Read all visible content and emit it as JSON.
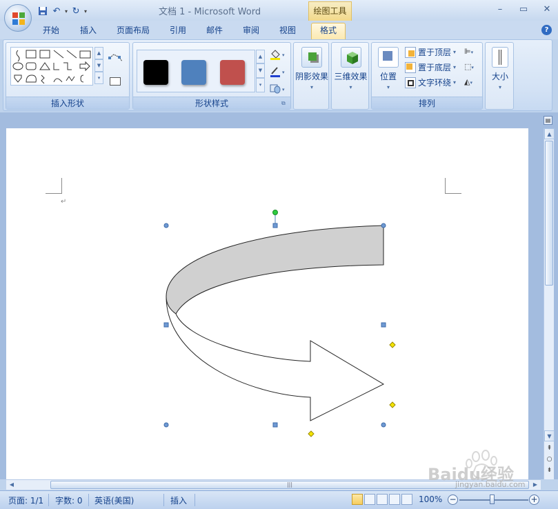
{
  "window": {
    "title": "文档 1 - Microsoft Word",
    "contextual_tab": "绘图工具"
  },
  "tabs": [
    {
      "label": "开始"
    },
    {
      "label": "插入"
    },
    {
      "label": "页面布局"
    },
    {
      "label": "引用"
    },
    {
      "label": "邮件"
    },
    {
      "label": "审阅"
    },
    {
      "label": "视图"
    },
    {
      "label": "格式",
      "active": true
    }
  ],
  "ribbon": {
    "insert_shapes": {
      "label": "插入形状"
    },
    "shape_styles": {
      "label": "形状样式",
      "swatches": [
        "#000000",
        "#4f81bd",
        "#c0504d"
      ]
    },
    "shadow": {
      "label": "阴影效果"
    },
    "threed": {
      "label": "三维效果"
    },
    "arrange": {
      "label": "排列",
      "position": "位置",
      "bring_front": "置于顶层",
      "send_back": "置于底层",
      "text_wrap": "文字环绕"
    },
    "size": {
      "label": "大小"
    }
  },
  "status": {
    "page": "页面: 1/1",
    "words": "字数: 0",
    "language": "英语(美国)",
    "mode": "插入",
    "zoom": "100%"
  },
  "watermark": {
    "brand": "Baidu经验",
    "url": "jingyan.baidu.com"
  },
  "colors": {
    "accent": "#15428b",
    "ribbon_bg": "#d3e2f5",
    "shape_fill": "#d0d0d0",
    "handle_blue": "#4f81bd",
    "handle_green": "#2ecc40",
    "handle_yellow": "#f5e500"
  }
}
